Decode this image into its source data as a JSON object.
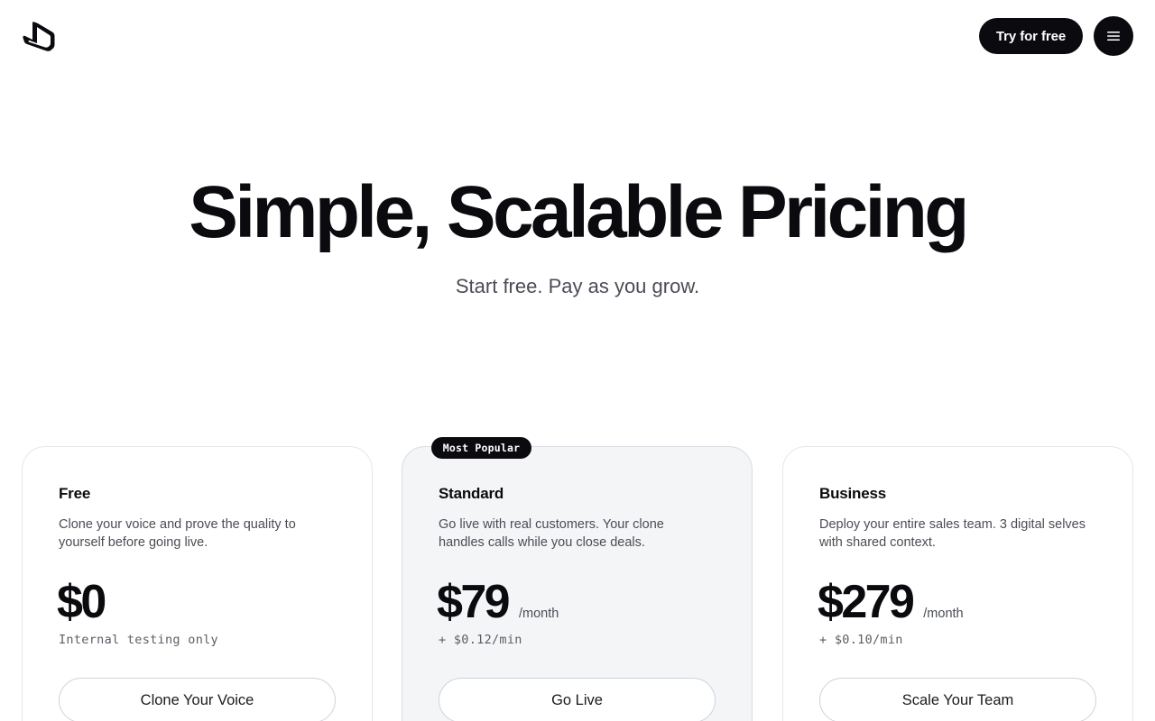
{
  "header": {
    "logo_icon": "brand-logo-icon",
    "try_label": "Try for free",
    "menu_icon": "hamburger-menu-icon"
  },
  "hero": {
    "title": "Simple, Scalable Pricing",
    "subtitle": "Start free. Pay as you grow."
  },
  "plans": [
    {
      "name": "Free",
      "description": "Clone your voice and prove the quality to yourself before going live.",
      "price": "$0",
      "period": "",
      "note": "Internal testing only",
      "cta": "Clone Your Voice"
    },
    {
      "name": "Standard",
      "badge": "Most Popular",
      "description": "Go live with real customers. Your clone handles calls while you close deals.",
      "price": "$79",
      "period": "/month",
      "note": "+ $0.12/min",
      "cta": "Go Live"
    },
    {
      "name": "Business",
      "description": "Deploy your entire sales team. 3 digital selves with shared context.",
      "price": "$279",
      "period": "/month",
      "note": "+ $0.10/min",
      "cta": "Scale Your Team"
    }
  ],
  "colors": {
    "primary": "#0b0b0f",
    "muted_text": "#4a4d55",
    "popular_card_bg": "#f3f5f7",
    "card_border": "#e5e7eb"
  }
}
